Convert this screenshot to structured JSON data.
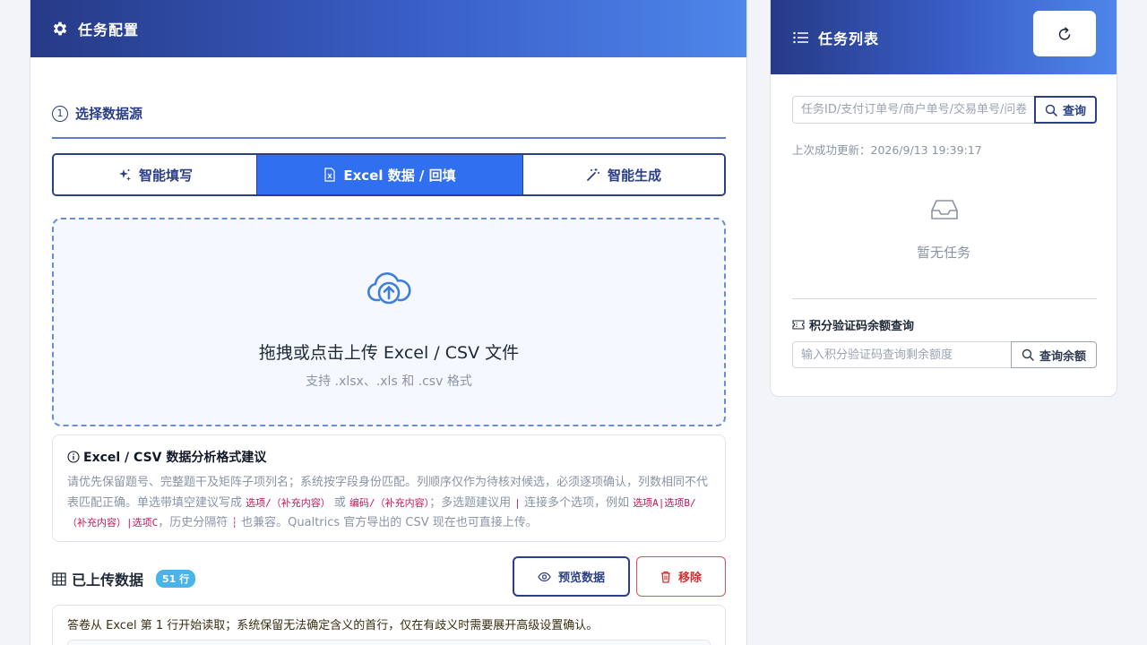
{
  "config_panel": {
    "title": "任务配置",
    "step": {
      "number": "1",
      "title": "选择数据源"
    },
    "tabs": [
      {
        "label": "智能填写",
        "icon": "sparkles-icon",
        "active": false
      },
      {
        "label": "Excel 数据 / 回填",
        "icon": "excel-file-icon",
        "active": true
      },
      {
        "label": "智能生成",
        "icon": "magic-wand-icon",
        "active": false
      }
    ],
    "dropzone": {
      "title": "拖拽或点击上传 Excel / CSV 文件",
      "subtitle": "支持 .xlsx、.xls 和 .csv 格式",
      "icon": "cloud-upload-icon"
    },
    "format_tip": {
      "title": "Excel / CSV 数据分析格式建议",
      "p1": "请优先保留题号、完整题干及矩阵子项列名；系统按字段身份匹配。列顺序仅作为待核对候选，必须逐项确认，列数相同不代表匹配正确。单选带填空建议写成 ",
      "code1": "选项/（补充内容）",
      "p2": " 或 ",
      "code2": "编码/（补充内容）",
      "p3": "；多选题建议用 ",
      "code3": "|",
      "p4": " 连接多个选项，例如 ",
      "code4": "选项A|选项B/（补充内容）|选项C",
      "p5": "，历史分隔符 ",
      "code5": "┆",
      "p6": " 也兼容。Qualtrics 官方导出的 CSV 现在也可直接上传。"
    },
    "uploaded": {
      "title": "已上传数据",
      "rows_badge": "51 行",
      "preview_label": "预览数据",
      "remove_label": "移除"
    },
    "note": "答卷从 Excel 第 1 行开始读取；系统保留无法确定含义的首行，仅在有歧义时需要展开高级设置确认。"
  },
  "task_panel": {
    "title": "任务列表",
    "search_placeholder": "任务ID/支付订单号/商户单号/交易单号/问卷链接",
    "query_label": "查询",
    "last_update": "上次成功更新：2026/9/13 19:39:17",
    "empty_text": "暂无任务",
    "credit_title": "积分验证码余额查询",
    "credit_placeholder": "输入积分验证码查询剩余额度",
    "credit_button": "查询余额"
  },
  "colors": {
    "brand_dark": "#263a86",
    "brand_light": "#4e86ea",
    "active_tab": "#2f6ff0",
    "danger": "#d0312d",
    "badge": "#4ab3e8"
  }
}
